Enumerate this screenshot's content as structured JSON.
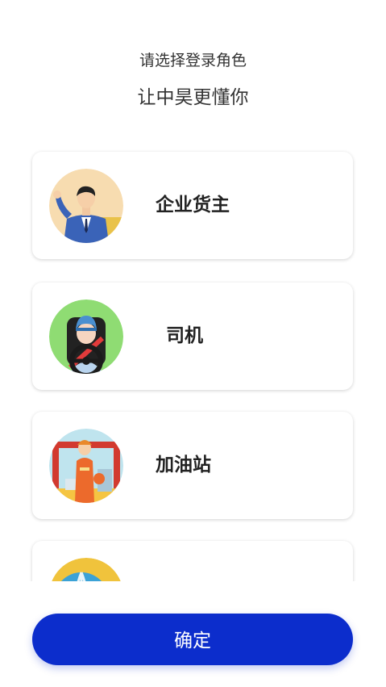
{
  "header": {
    "subtitle": "请选择登录角色",
    "title": "让中昊更懂你"
  },
  "roles": [
    {
      "label": "企业货主",
      "icon": "businessman-avatar-icon"
    },
    {
      "label": "司机",
      "icon": "driver-avatar-icon"
    },
    {
      "label": "加油站",
      "icon": "gas-station-worker-avatar-icon"
    },
    {
      "label": "",
      "icon": "globe-avatar-icon"
    }
  ],
  "confirm_label": "确定",
  "colors": {
    "primary": "#0c2dcc",
    "background": "#ffffff",
    "card_text": "#222222"
  }
}
